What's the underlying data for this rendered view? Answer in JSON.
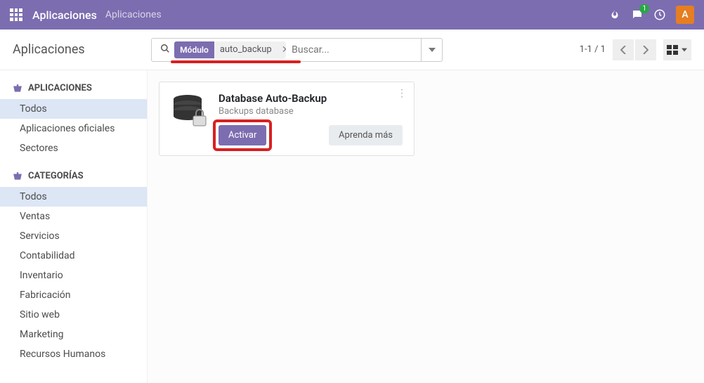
{
  "topbar": {
    "app_name": "Aplicaciones",
    "breadcrumb": "Aplicaciones",
    "chat_badge": "1",
    "avatar_letter": "A"
  },
  "controlbar": {
    "title": "Aplicaciones",
    "facet_label": "Módulo",
    "facet_value": "auto_backup",
    "search_placeholder": "Buscar...",
    "pager": "1-1 / 1"
  },
  "sidebar": {
    "section1_title": "APLICACIONES",
    "section1_items": [
      "Todos",
      "Aplicaciones oficiales",
      "Sectores"
    ],
    "section2_title": "CATEGORÍAS",
    "section2_items": [
      "Todos",
      "Ventas",
      "Servicios",
      "Contabilidad",
      "Inventario",
      "Fabricación",
      "Sitio web",
      "Marketing",
      "Recursos Humanos"
    ]
  },
  "card": {
    "title": "Database Auto-Backup",
    "subtitle": "Backups database",
    "activate": "Activar",
    "learn_more": "Aprenda más"
  }
}
